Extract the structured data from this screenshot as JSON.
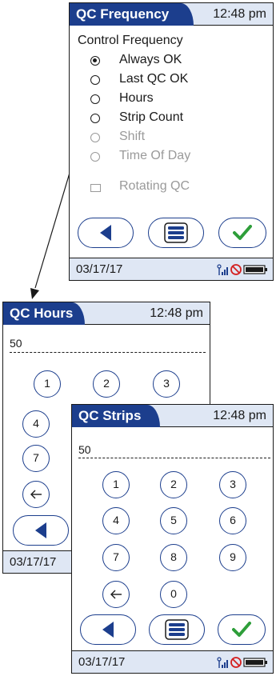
{
  "qc_frequency": {
    "title": "QC Frequency",
    "time": "12:48 pm",
    "section_label": "Control Frequency",
    "options": [
      {
        "label": "Always OK",
        "selected": true,
        "enabled": true
      },
      {
        "label": "Last QC OK",
        "selected": false,
        "enabled": true
      },
      {
        "label": "Hours",
        "selected": false,
        "enabled": true
      },
      {
        "label": "Strip Count",
        "selected": false,
        "enabled": true
      },
      {
        "label": "Shift",
        "selected": false,
        "enabled": false
      },
      {
        "label": "Time Of Day",
        "selected": false,
        "enabled": false
      }
    ],
    "rotating_qc": {
      "label": "Rotating QC",
      "checked": false,
      "enabled": false
    },
    "date": "03/17/17"
  },
  "qc_hours": {
    "title": "QC Hours",
    "time": "12:48 pm",
    "value": "50",
    "keys": [
      "1",
      "2",
      "3",
      "4",
      "7"
    ],
    "date": "03/17/17"
  },
  "qc_strips": {
    "title": "QC Strips",
    "time": "12:48 pm",
    "value": "50",
    "keys": [
      "1",
      "2",
      "3",
      "4",
      "5",
      "6",
      "7",
      "8",
      "9",
      "0"
    ],
    "date": "03/17/17"
  },
  "icons": {
    "back": "back-arrow-icon",
    "menu": "menu-list-icon",
    "confirm": "checkmark-icon",
    "backspace": "backspace-arrow-icon",
    "wireless": "wireless-signal-icon",
    "no_connection": "no-connection-icon",
    "battery": "battery-icon"
  },
  "colors": {
    "accent": "#1c3e8d",
    "header_bg": "#dfe7f4",
    "confirm_green": "#2e9e3a",
    "disabled": "#9a9a9a"
  }
}
